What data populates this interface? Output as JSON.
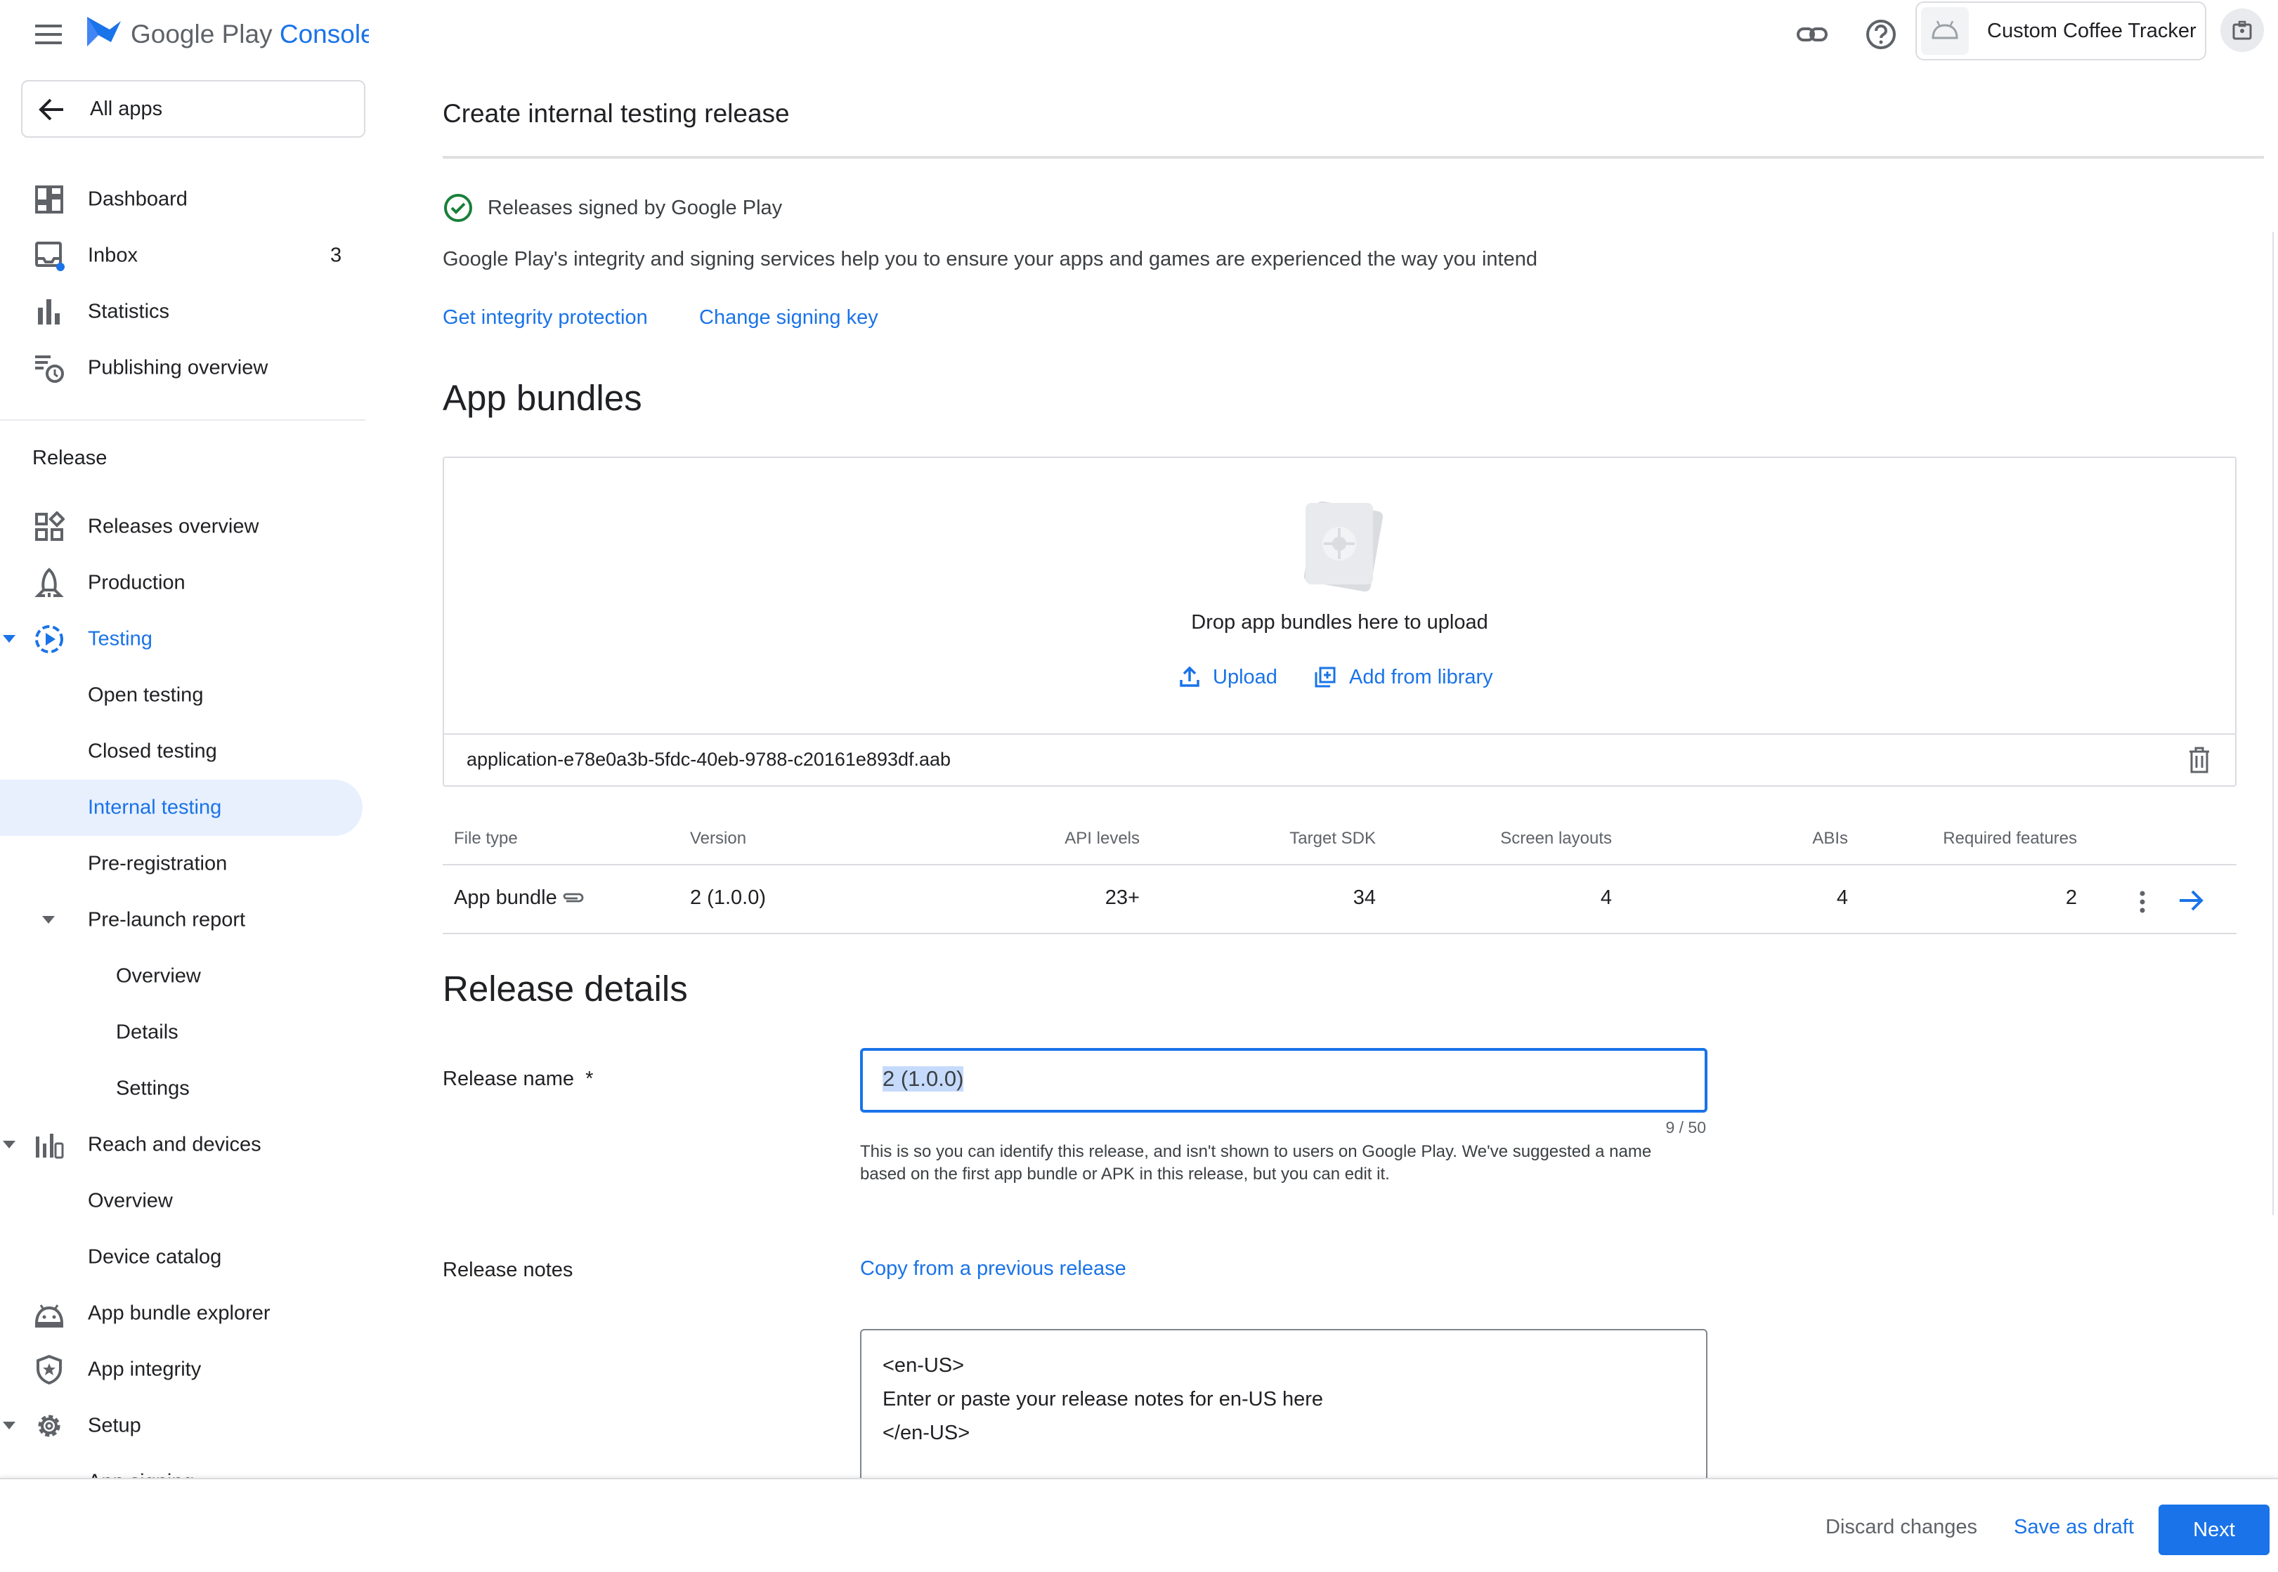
{
  "header": {
    "app_name_part1": "Google Play",
    "app_name_part2": "Console",
    "app_selector_label": "Custom Coffee Tracker"
  },
  "sidebar": {
    "all_apps": "All apps",
    "top_items": [
      {
        "label": "Dashboard",
        "icon": "dashboard-icon"
      },
      {
        "label": "Inbox",
        "icon": "inbox-icon",
        "count": "3"
      },
      {
        "label": "Statistics",
        "icon": "statistics-icon"
      },
      {
        "label": "Publishing overview",
        "icon": "publishing-overview-icon"
      }
    ],
    "release_header": "Release",
    "release_items": {
      "releases_overview": "Releases overview",
      "production": "Production",
      "testing": "Testing",
      "open_testing": "Open testing",
      "closed_testing": "Closed testing",
      "internal_testing": "Internal testing",
      "pre_registration": "Pre-registration",
      "pre_launch_report": "Pre-launch report",
      "plr_overview": "Overview",
      "plr_details": "Details",
      "plr_settings": "Settings",
      "reach_and_devices": "Reach and devices",
      "rad_overview": "Overview",
      "device_catalog": "Device catalog",
      "app_bundle_explorer": "App bundle explorer",
      "app_integrity": "App integrity",
      "setup": "Setup",
      "app_signing": "App signing"
    },
    "active_color": "#e8f0fe"
  },
  "main": {
    "page_title": "Create internal testing release",
    "signing": {
      "status": "Releases signed by Google Play",
      "description": "Google Play's integrity and signing services help you to ensure your apps and games are experienced the way you intend",
      "link_integrity": "Get integrity protection",
      "link_change_key": "Change signing key"
    },
    "bundles": {
      "heading": "App bundles",
      "drop_text": "Drop app bundles here to upload",
      "upload": "Upload",
      "add_from_library": "Add from library",
      "file_name": "application-e78e0a3b-5fdc-40eb-9788-c20161e893df.aab",
      "table": {
        "headers": [
          "File type",
          "Version",
          "API levels",
          "Target SDK",
          "Screen layouts",
          "ABIs",
          "Required features"
        ],
        "row": [
          "App bundle",
          "2 (1.0.0)",
          "23+",
          "34",
          "4",
          "4",
          "2"
        ]
      }
    },
    "release_details": {
      "heading": "Release details",
      "name_label": "Release name",
      "required_mark": "*",
      "name_value": "2 (1.0.0)",
      "char_count": "9 / 50",
      "name_help_line1": "This is so you can identify this release, and isn't shown to users on Google Play. We've suggested a name",
      "name_help_line2": "based on the first app bundle or APK in this release, but you can edit it.",
      "notes_label": "Release notes",
      "copy_previous": "Copy from a previous release",
      "notes_line1": "<en-US>",
      "notes_line2": "Enter or paste your release notes for en-US here",
      "notes_line3": "</en-US>"
    }
  },
  "footer": {
    "discard": "Discard changes",
    "save_draft": "Save as draft",
    "next": "Next"
  },
  "colors": {
    "accent": "#1a73e8",
    "success": "#188038"
  }
}
